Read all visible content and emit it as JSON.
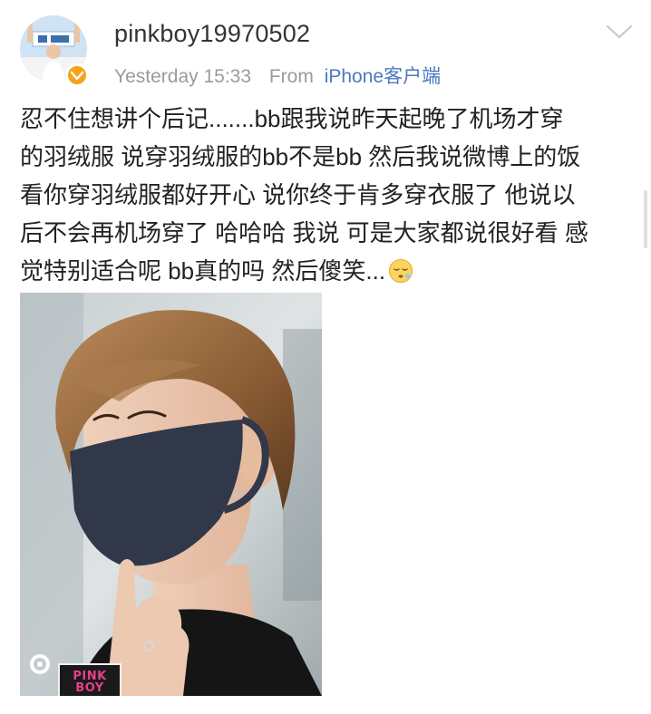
{
  "post": {
    "username": "pinkboy19970502",
    "timestamp": "Yesterday 15:33",
    "from_label": "From",
    "source": "iPhone客户端",
    "text_lines": [
      "忍不住想讲个后记.......bb跟我说昨天起晚了机场才穿",
      "的羽绒服 说穿羽绒服的bb不是bb 然后我说微博上的饭",
      "看你穿羽绒服都好开心 说你终于肯多穿衣服了 他说以",
      "后不会再机场穿了 哈哈哈 我说 可是大家都说很好看 感",
      "觉特别适合呢 bb真的吗 然后傻笑..."
    ],
    "emoji": "sleepy-face-icon"
  },
  "photo": {
    "watermark_text": "PINK BOY"
  },
  "icons": {
    "avatar": "avatar",
    "verified": "verified-badge-icon",
    "menu": "chevron-down-icon"
  },
  "colors": {
    "link": "#4a79c0",
    "meta": "#9b9b9b",
    "verified": "#f7a21b",
    "watermark": "#e83e8c"
  }
}
